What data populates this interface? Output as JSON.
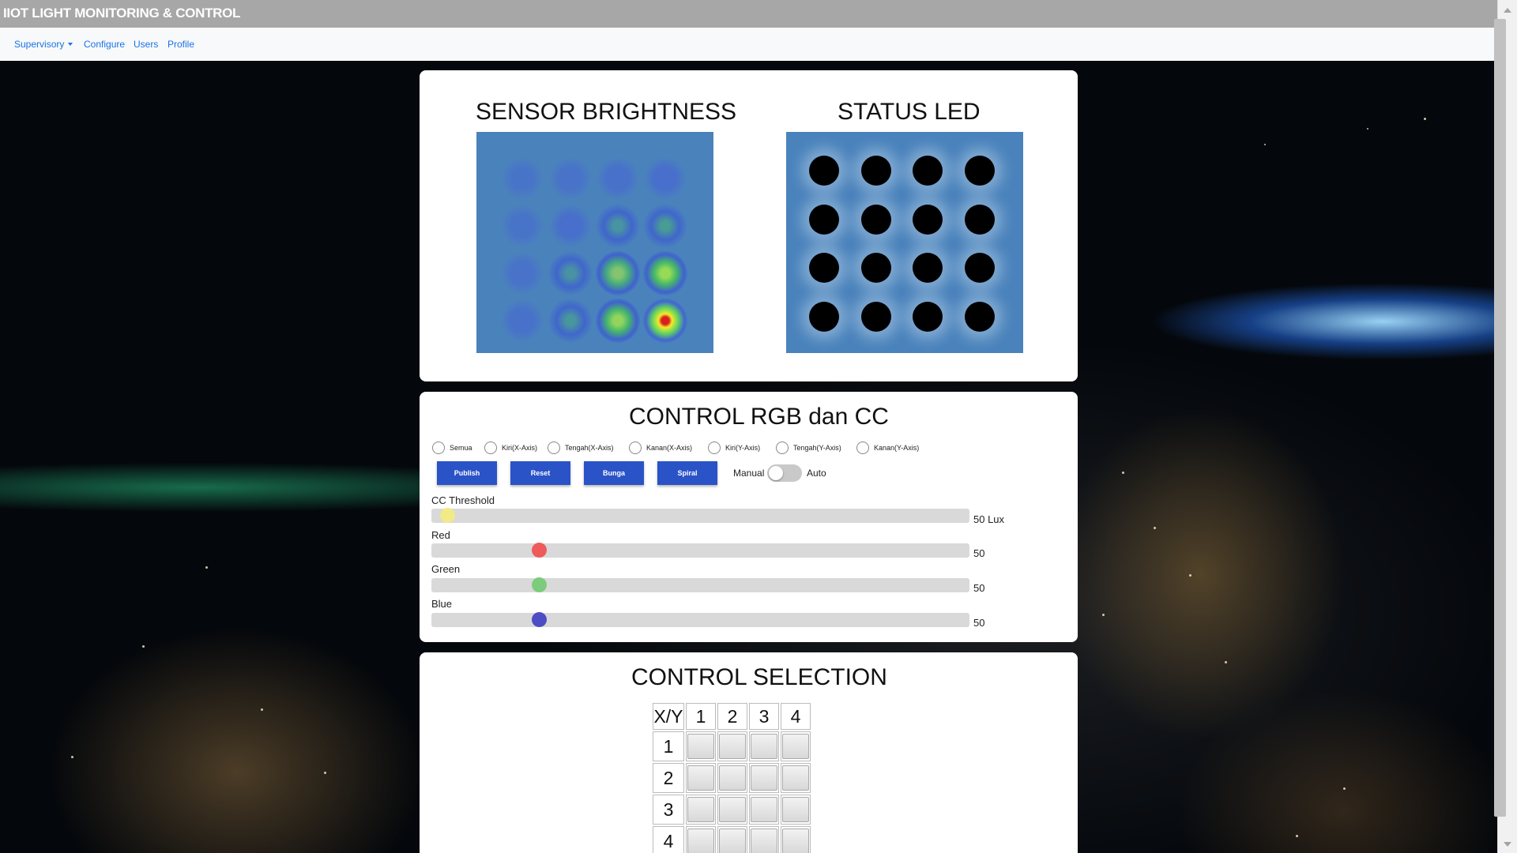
{
  "app": {
    "title": "IIOT LIGHT MONITORING & CONTROL"
  },
  "nav": {
    "items": [
      "Supervisory",
      "Configure",
      "Users",
      "Profile"
    ]
  },
  "sensor": {
    "title": "SENSOR BRIGHTNESS",
    "intensity": [
      [
        0.05,
        0.1,
        0.15,
        0.2
      ],
      [
        0.08,
        0.2,
        0.35,
        0.5
      ],
      [
        0.1,
        0.3,
        0.6,
        0.8
      ],
      [
        0.15,
        0.4,
        0.75,
        1.0
      ]
    ]
  },
  "status_led": {
    "title": "STATUS LED",
    "leds": [
      [
        0,
        0,
        0,
        0
      ],
      [
        0,
        0,
        0,
        0
      ],
      [
        0,
        0,
        0,
        0
      ],
      [
        0,
        0,
        0,
        0
      ]
    ],
    "off_color": "#000000"
  },
  "control_rgb": {
    "title": "CONTROL RGB dan CC",
    "radios": [
      "Semua",
      "Kiri(X-Axis)",
      "Tengah(X-Axis)",
      "Kanan(X-Axis)",
      "Kiri(Y-Axis)",
      "Tengah(Y-Axis)",
      "Kanan(Y-Axis)"
    ],
    "buttons": [
      "Publish",
      "Reset",
      "Bunga",
      "Spiral"
    ],
    "toggle": {
      "left": "Manual",
      "right": "Auto",
      "value": "Manual"
    },
    "sliders": [
      {
        "label": "CC Threshold",
        "value": "50 Lux",
        "position": 0.03,
        "color": "#f2ea86"
      },
      {
        "label": "Red",
        "value": "50",
        "position": 0.2,
        "color": "#ee5b5b"
      },
      {
        "label": "Green",
        "value": "50",
        "position": 0.2,
        "color": "#7dcb7d"
      },
      {
        "label": "Blue",
        "value": "50",
        "position": 0.2,
        "color": "#4d4dc4"
      }
    ]
  },
  "control_selection": {
    "title": "CONTROL SELECTION",
    "corner": "X/Y",
    "columns": [
      "1",
      "2",
      "3",
      "4"
    ],
    "rows": [
      "1",
      "2",
      "3",
      "4"
    ]
  },
  "colors": {
    "button": "#2a53c8",
    "link": "#1a73e8",
    "panel": "#4a83bc"
  }
}
